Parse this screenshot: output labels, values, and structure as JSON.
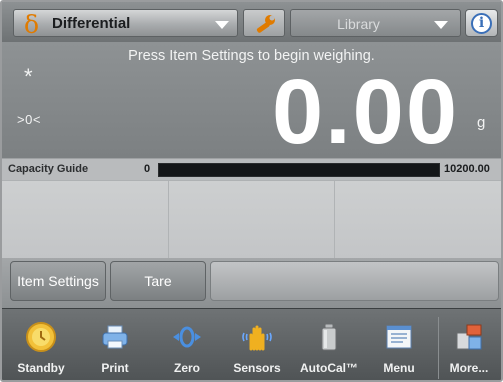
{
  "header": {
    "app_icon": "delta-icon",
    "app_name": "Differential",
    "settings_icon": "wrench-icon",
    "library_label": "Library",
    "info_icon": "info-icon",
    "info_glyph": "i"
  },
  "display": {
    "message": "Press Item Settings to begin weighing.",
    "stable_indicator": "*",
    "center_zero_indicator": ">0<",
    "weight": "0.00",
    "unit": "g"
  },
  "capacity_guide": {
    "label": "Capacity Guide",
    "min": "0",
    "max": "10200.00",
    "fill_fraction": 1.0
  },
  "actions": {
    "item_settings": "Item Settings",
    "tare": "Tare"
  },
  "toolbar": {
    "items": [
      {
        "label": "Standby",
        "icon": "standby-icon"
      },
      {
        "label": "Print",
        "icon": "printer-icon"
      },
      {
        "label": "Zero",
        "icon": "zero-icon"
      },
      {
        "label": "Sensors",
        "icon": "sensors-hand-icon"
      },
      {
        "label": "AutoCal™",
        "icon": "calibration-weight-icon"
      },
      {
        "label": "Menu",
        "icon": "menu-icon"
      },
      {
        "label": "More...",
        "icon": "more-icon"
      }
    ]
  },
  "colors": {
    "accent_orange": "#e07b00",
    "info_blue": "#3a6fb8",
    "background_gray": "#7e8284"
  }
}
